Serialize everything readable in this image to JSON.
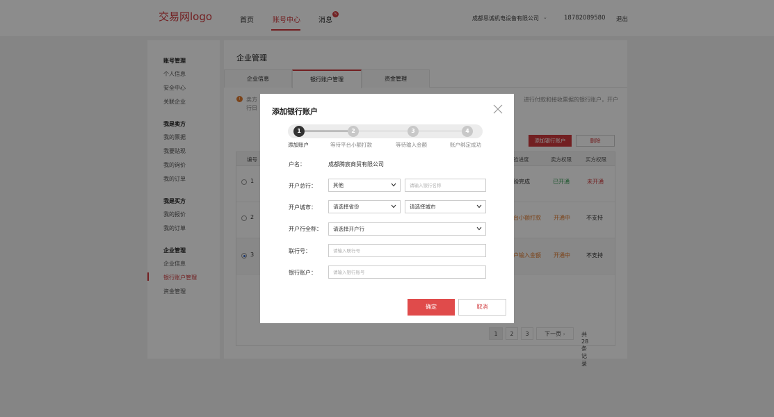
{
  "header": {
    "logo": "交易网logo",
    "nav": [
      "首页",
      "账号中心",
      "消息"
    ],
    "message_count": "5",
    "company": "成都思诚机电设备有限公司",
    "phone": "18782089580",
    "logout": "退出"
  },
  "sidebar": {
    "groups": [
      {
        "title": "账号管理",
        "items": [
          "个人信息",
          "安全中心",
          "关联企业"
        ]
      },
      {
        "title": "我是卖方",
        "items": [
          "我的票据",
          "我要贴现",
          "我的询价",
          "我的订单"
        ]
      },
      {
        "title": "我是买方",
        "items": [
          "我的报价",
          "我的订单"
        ]
      },
      {
        "title": "企业管理",
        "items": [
          "企业信息",
          "银行账户管理",
          "资金管理"
        ]
      }
    ]
  },
  "main": {
    "title": "企业管理",
    "tabs": [
      "企业信息",
      "银行账户管理",
      "资金管理"
    ],
    "notice_line1": "卖方",
    "notice_line2": "行日",
    "notice_right": "进行付款和接收票据的银行账户，开户",
    "add_button": "添加银行账户",
    "delete_button": "删除",
    "columns": [
      "编号",
      "验进度",
      "卖方权限",
      "买方权限"
    ],
    "rows": [
      {
        "no": "1",
        "progress": "验完成",
        "seller": "已开通",
        "buyer": "未开通"
      },
      {
        "no": "2",
        "progress": "台小额打款",
        "seller": "开通中",
        "buyer": "不支持"
      },
      {
        "no": "3",
        "progress": "户输入金额",
        "seller": "开通中",
        "buyer": "不支持"
      }
    ],
    "pager": {
      "pages": [
        "1",
        "2",
        "3"
      ],
      "next": "下一页",
      "next_icon": "chevron-right-icon",
      "total": "共28条记录"
    }
  },
  "modal": {
    "title": "添加银行账户",
    "steps": [
      {
        "num": "1",
        "label": "添加账户"
      },
      {
        "num": "2",
        "label": "等待平台小额打款"
      },
      {
        "num": "3",
        "label": "等待输入金额"
      },
      {
        "num": "4",
        "label": "账户绑定成功"
      }
    ],
    "fields": {
      "account_name_label": "户名：",
      "account_name_value": "成都腾宸商贸有限公司",
      "head_bank_label": "开户总行：",
      "head_bank_value": "其他",
      "bank_name_placeholder": "请输入银行名称",
      "city_label": "开户城市：",
      "province_value": "请选择省份",
      "city_value": "请选择城市",
      "branch_label": "开户行全称：",
      "branch_value": "请选择开户行",
      "union_no_label": "联行号：",
      "union_no_placeholder": "请输入联行号",
      "account_no_label": "银行账户：",
      "account_no_placeholder": "请输入银行账号"
    },
    "ok": "确定",
    "cancel": "取消"
  },
  "colors": {
    "accent": "#d0393c",
    "ok_button": "#e04b4b",
    "green": "#2e9a4e",
    "orange": "#e07a2e"
  }
}
